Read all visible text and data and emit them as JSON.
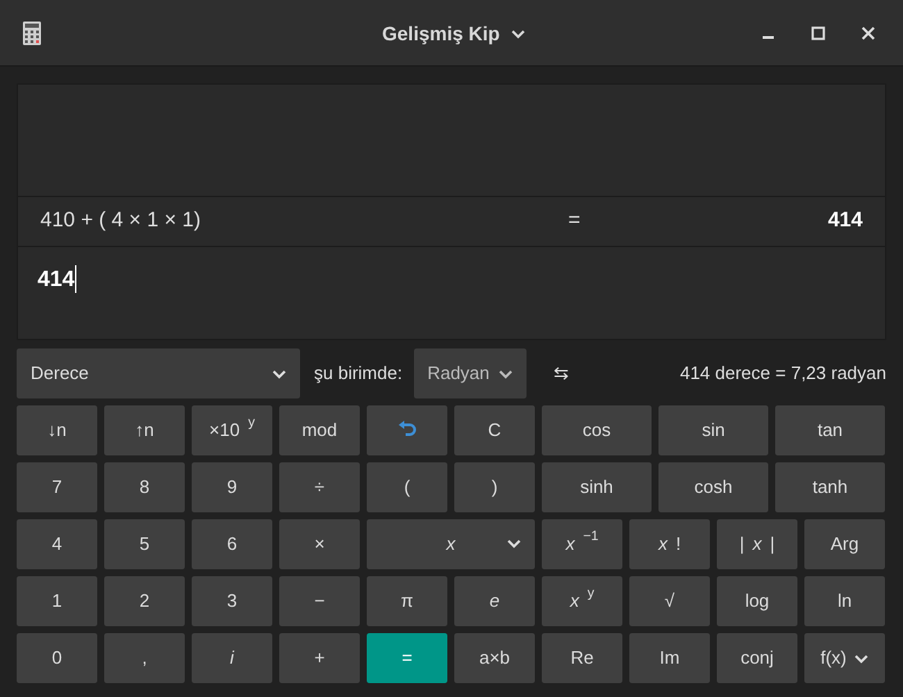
{
  "window": {
    "title": "Gelişmiş Kip"
  },
  "display": {
    "history": [
      {
        "expression": "410 + ( 4 × 1 × 1)",
        "equals": "=",
        "result": "414"
      }
    ],
    "input": "414"
  },
  "conversion": {
    "from_unit": "Derece",
    "label": "şu birimde:",
    "to_unit": "Radyan",
    "swap": "⇆",
    "result": "414 derece = 7,23 radyan"
  },
  "keypad": [
    [
      {
        "label": "↓n",
        "kind": "text"
      },
      {
        "label": "↑n",
        "kind": "text"
      },
      {
        "label": "×10$^{y}$",
        "kind": "text"
      },
      {
        "label": "mod",
        "kind": "text"
      },
      {
        "kind": "undo"
      },
      {
        "label": "C",
        "kind": "text"
      },
      {
        "label": "cos",
        "kind": "text"
      },
      {
        "label": "sin",
        "kind": "text"
      },
      {
        "label": "tan",
        "kind": "text"
      }
    ],
    [
      {
        "label": "7",
        "kind": "text"
      },
      {
        "label": "8",
        "kind": "text"
      },
      {
        "label": "9",
        "kind": "text"
      },
      {
        "label": "÷",
        "kind": "text"
      },
      {
        "label": "(",
        "kind": "text"
      },
      {
        "label": ")",
        "kind": "text"
      },
      {
        "label": "sinh",
        "kind": "text"
      },
      {
        "label": "cosh",
        "kind": "text"
      },
      {
        "label": "tanh",
        "kind": "text"
      }
    ],
    [
      {
        "label": "4",
        "kind": "text"
      },
      {
        "label": "5",
        "kind": "text"
      },
      {
        "label": "6",
        "kind": "text"
      },
      {
        "label": "×",
        "kind": "text"
      },
      {
        "label": "x",
        "kind": "dropdown"
      },
      {
        "label": "*x*$^{−1}$",
        "kind": "text"
      },
      {
        "label": "*x*!",
        "kind": "text"
      },
      {
        "label": "|*x*|",
        "kind": "text"
      },
      {
        "label": "Arg",
        "kind": "text"
      }
    ],
    [
      {
        "label": "1",
        "kind": "text"
      },
      {
        "label": "2",
        "kind": "text"
      },
      {
        "label": "3",
        "kind": "text"
      },
      {
        "label": "−",
        "kind": "text"
      },
      {
        "label": "π",
        "kind": "text"
      },
      {
        "label": "e",
        "kind": "italic"
      },
      {
        "label": "*x*$^{y}$",
        "kind": "text"
      },
      {
        "label": "√",
        "kind": "text"
      },
      {
        "label": "log",
        "kind": "text"
      },
      {
        "label": "ln",
        "kind": "text"
      }
    ],
    [
      {
        "label": "0",
        "kind": "text"
      },
      {
        "label": ",",
        "kind": "text"
      },
      {
        "label": "i",
        "kind": "italic"
      },
      {
        "label": "+",
        "kind": "text"
      },
      {
        "label": "=",
        "kind": "accent"
      },
      {
        "label": "a×b",
        "kind": "text"
      },
      {
        "label": "Re",
        "kind": "text"
      },
      {
        "label": "Im",
        "kind": "text"
      },
      {
        "label": "conj",
        "kind": "text"
      },
      {
        "label": "f(x)",
        "kind": "menu"
      }
    ]
  ]
}
